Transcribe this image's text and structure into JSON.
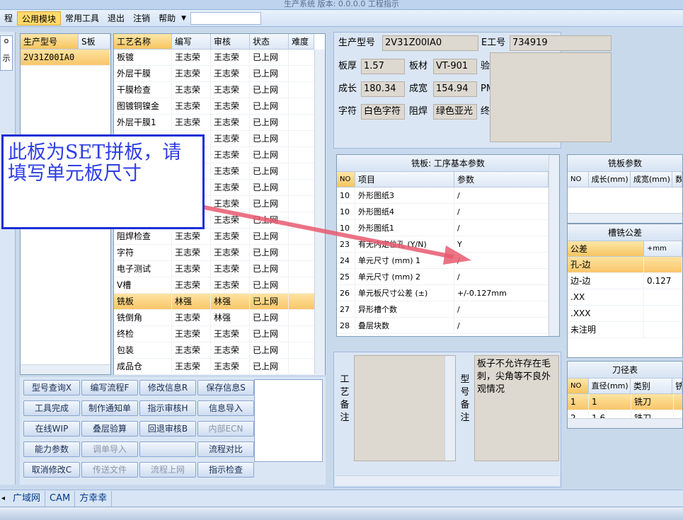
{
  "window": {
    "title": "生产系统 版本: 0.0.0.0 工程指示"
  },
  "menu": {
    "item0": "程",
    "items": [
      "公用模块",
      "常用工具",
      "退出",
      "注销",
      "帮助"
    ],
    "arrow": "▼"
  },
  "left_stub": {
    "labels": [
      "o",
      "示"
    ]
  },
  "model_list": {
    "headers": [
      "生产型号",
      "S板"
    ],
    "rows": [
      [
        "2V31Z00IA0",
        ""
      ]
    ]
  },
  "process_grid": {
    "headers": [
      "工艺名称",
      "编写",
      "审核",
      "状态",
      "难度"
    ],
    "rows": [
      [
        "板镀",
        "王志荣",
        "王志荣",
        "已上网"
      ],
      [
        "外层干膜",
        "王志荣",
        "王志荣",
        "已上网"
      ],
      [
        "干膜检查",
        "王志荣",
        "王志荣",
        "已上网"
      ],
      [
        "图镀铜镍金",
        "王志荣",
        "王志荣",
        "已上网"
      ],
      [
        "外层干膜1",
        "王志荣",
        "王志荣",
        "已上网"
      ],
      [
        "",
        "",
        "王志荣",
        "已上网"
      ],
      [
        "",
        "",
        "王志荣",
        "已上网"
      ],
      [
        "",
        "",
        "王志荣",
        "已上网"
      ],
      [
        "",
        "",
        "王志荣",
        "已上网"
      ],
      [
        "",
        "",
        "王志荣",
        "已上网"
      ],
      [
        "",
        "",
        "王志荣",
        "已上网"
      ],
      [
        "阻焊检查",
        "王志荣",
        "王志荣",
        "已上网"
      ],
      [
        "字符",
        "王志荣",
        "王志荣",
        "已上网"
      ],
      [
        "电子测试",
        "王志荣",
        "王志荣",
        "已上网"
      ],
      [
        "V槽",
        "王志荣",
        "王志荣",
        "已上网"
      ],
      [
        "铣板",
        "林强",
        "林强",
        "已上网"
      ],
      [
        "铣倒角",
        "王志荣",
        "林强",
        "已上网"
      ],
      [
        "终检",
        "王志荣",
        "王志荣",
        "已上网"
      ],
      [
        "包装",
        "王志荣",
        "王志荣",
        "已上网"
      ],
      [
        "成品仓",
        "王志荣",
        "王志荣",
        "已上网"
      ]
    ],
    "selected_index": 15
  },
  "buttons": [
    [
      "型号查询X",
      "编写流程F",
      "修改信息R",
      "保存信息S"
    ],
    [
      "工具完成",
      "制作通知单",
      "指示审核H",
      "信息导入"
    ],
    [
      "在线WIP",
      "叠层验算",
      "回退审核B",
      "内部ECN"
    ],
    [
      "能力参数",
      "调单导入",
      "",
      "流程对比"
    ],
    [
      "取消修改C",
      "传送文件",
      "流程上网",
      "指示检查"
    ]
  ],
  "buttons_disabled": [
    [
      false,
      false,
      false,
      false
    ],
    [
      false,
      false,
      false,
      false
    ],
    [
      false,
      false,
      false,
      true
    ],
    [
      false,
      true,
      false,
      false
    ],
    [
      false,
      true,
      true,
      false
    ]
  ],
  "info": {
    "model_label": "生产型号",
    "model_value": "2V31Z00IA0",
    "eng_label": "E工号",
    "eng_value": "734919",
    "thick_label": "板厚",
    "thick_value": "1.57",
    "mat_label": "板材",
    "mat_value": "VT-901",
    "verify_label": "验",
    "len_label": "成长",
    "len_value": "180.34",
    "wid_label": "成宽",
    "wid_value": "154.94",
    "pm_label": "PM",
    "char_label": "字符",
    "char_value": "白色字符",
    "mask_label": "阻焊",
    "mask_value": "绿色亚光",
    "final_label": "终"
  },
  "mill_params": {
    "title": "铣板: 工序基本参数",
    "headers": [
      "NO",
      "项目",
      "参数"
    ],
    "rows": [
      [
        "10",
        "外形图纸3",
        "/"
      ],
      [
        "10",
        "外形图纸4",
        "/"
      ],
      [
        "10",
        "外形图纸1",
        "/"
      ],
      [
        "23",
        "有无内定位孔 (Y/N)",
        "Y"
      ],
      [
        "24",
        "单元尺寸 (mm) 1",
        "/"
      ],
      [
        "25",
        "单元尺寸 (mm) 2",
        "/"
      ],
      [
        "26",
        "单元板尺寸公差 (±)",
        "+/-0.127mm"
      ],
      [
        "27",
        "异形槽个数",
        "/"
      ],
      [
        "28",
        "叠层块数",
        "/"
      ]
    ]
  },
  "mill_board": {
    "title": "铣板参数",
    "headers": [
      "NO",
      "成长(mm)",
      "成宽(mm)",
      "数"
    ]
  },
  "slot_tol": {
    "title": "槽铣公差",
    "headers": [
      "公差",
      "+mm"
    ],
    "rows": [
      [
        "孔-边",
        ""
      ],
      [
        "边-边",
        "0.127"
      ],
      [
        ".XX",
        ""
      ],
      [
        ".XXX",
        ""
      ],
      [
        "未注明",
        ""
      ]
    ]
  },
  "tool_dia": {
    "title": "刀径表",
    "headers": [
      "NO",
      "直径(mm)",
      "类别",
      "铣"
    ],
    "rows": [
      [
        "1",
        "1",
        "铣刀"
      ],
      [
        "2",
        "1.6",
        "铣刀"
      ]
    ]
  },
  "notes": {
    "process_label": "工艺备注",
    "model_label": "型号备注",
    "model_text": "板子不允许存在毛刺，尖角等不良外观情况"
  },
  "callout": {
    "text": "此板为SET拼板，请填写单元板尺寸"
  },
  "tabs": [
    "广域网",
    "CAM",
    "方幸幸"
  ],
  "accent": "#f8c66a",
  "arrow_color": "#e85a6e"
}
